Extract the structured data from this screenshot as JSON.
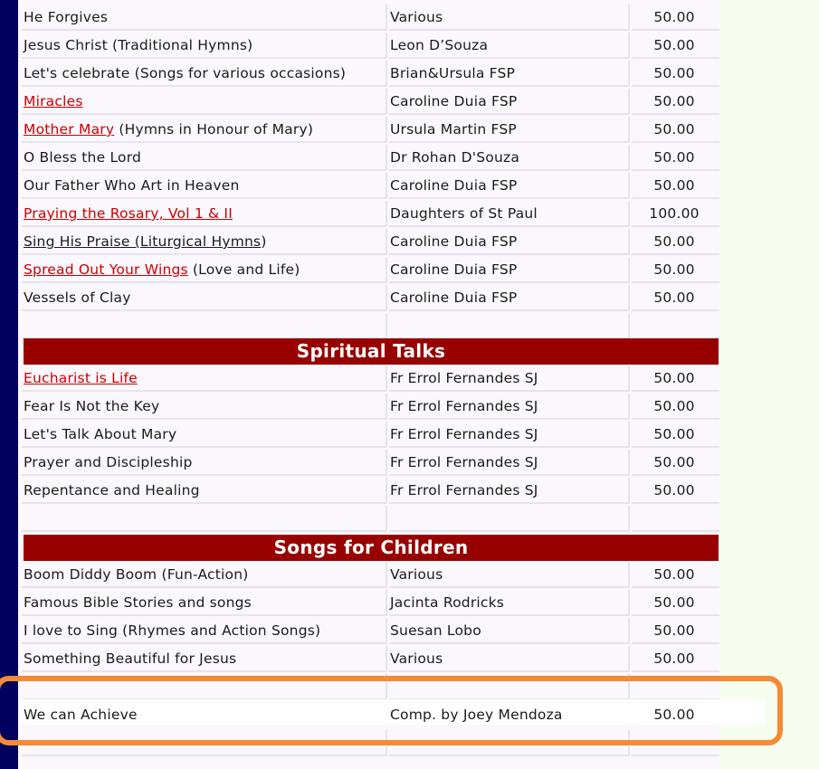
{
  "colors": {
    "left_bar": "#00005e",
    "section_header_bg": "#980000",
    "section_header_text": "#ffffff",
    "link_red": "#cc0000",
    "highlight_border": "#f58a36",
    "page_bg": "#f6fdee"
  },
  "rows_top": [
    {
      "title": "He Forgives",
      "artist": "Various",
      "price": "50.00"
    },
    {
      "title": "Jesus Christ (Traditional Hymns)",
      "artist": "Leon D’Souza",
      "price": "50.00"
    },
    {
      "title": "Let's celebrate (Songs for various occasions)",
      "artist": "Brian&Ursula FSP",
      "price": "50.00"
    },
    {
      "title_link": "Miracles",
      "artist": "Caroline Duia FSP",
      "price": "50.00"
    },
    {
      "title_link": "Mother Mary",
      "title_suffix": " (Hymns in Honour of Mary)",
      "artist": "Ursula Martin FSP",
      "price": "50.00"
    },
    {
      "title": "O Bless the Lord",
      "artist": "Dr Rohan D'Souza",
      "price": "50.00"
    },
    {
      "title": "Our Father Who Art in Heaven",
      "artist": "Caroline Duia FSP",
      "price": "50.00"
    },
    {
      "title_link": "Praying the Rosary, Vol 1 & II",
      "artist": "Daughters of St Paul",
      "price": "100.00"
    },
    {
      "title_dark_link": "Sing His Praise (Liturgical Hymns",
      "title_suffix": ")",
      "artist": "Caroline Duia FSP",
      "price": "50.00"
    },
    {
      "title_link": "Spread Out Your Wings",
      "title_suffix": " (Love and Life)",
      "artist": "Caroline Duia FSP",
      "price": "50.00"
    },
    {
      "title": "Vessels of Clay",
      "artist": "Caroline Duia FSP",
      "price": "50.00"
    }
  ],
  "section_spiritual": {
    "header": "Spiritual Talks",
    "rows": [
      {
        "title_link": "Eucharist is Life",
        "artist": "Fr Errol Fernandes SJ",
        "price": "50.00"
      },
      {
        "title": "Fear Is Not the Key",
        "artist": "Fr Errol Fernandes SJ",
        "price": "50.00"
      },
      {
        "title": "Let's Talk About Mary",
        "artist": "Fr Errol Fernandes SJ",
        "price": "50.00"
      },
      {
        "title": "Prayer and Discipleship",
        "artist": "Fr Errol Fernandes SJ",
        "price": "50.00"
      },
      {
        "title": "Repentance and Healing",
        "artist": "Fr Errol Fernandes SJ",
        "price": "50.00"
      }
    ]
  },
  "section_children": {
    "header": "Songs for Children",
    "rows": [
      {
        "title": "Boom Diddy Boom (Fun-Action)",
        "artist": "Various",
        "price": "50.00"
      },
      {
        "title": "Famous Bible Stories and songs",
        "artist": "Jacinta Rodricks",
        "price": "50.00"
      },
      {
        "title": "I love to Sing (Rhymes and Action Songs)",
        "artist": "Suesan Lobo",
        "price": "50.00"
      },
      {
        "title": "Something Beautiful for Jesus",
        "artist": "Various",
        "price": "50.00"
      }
    ]
  },
  "highlighted_row": {
    "title": "We can Achieve",
    "artist": "Comp. by Joey Mendoza",
    "price": "50.00"
  }
}
